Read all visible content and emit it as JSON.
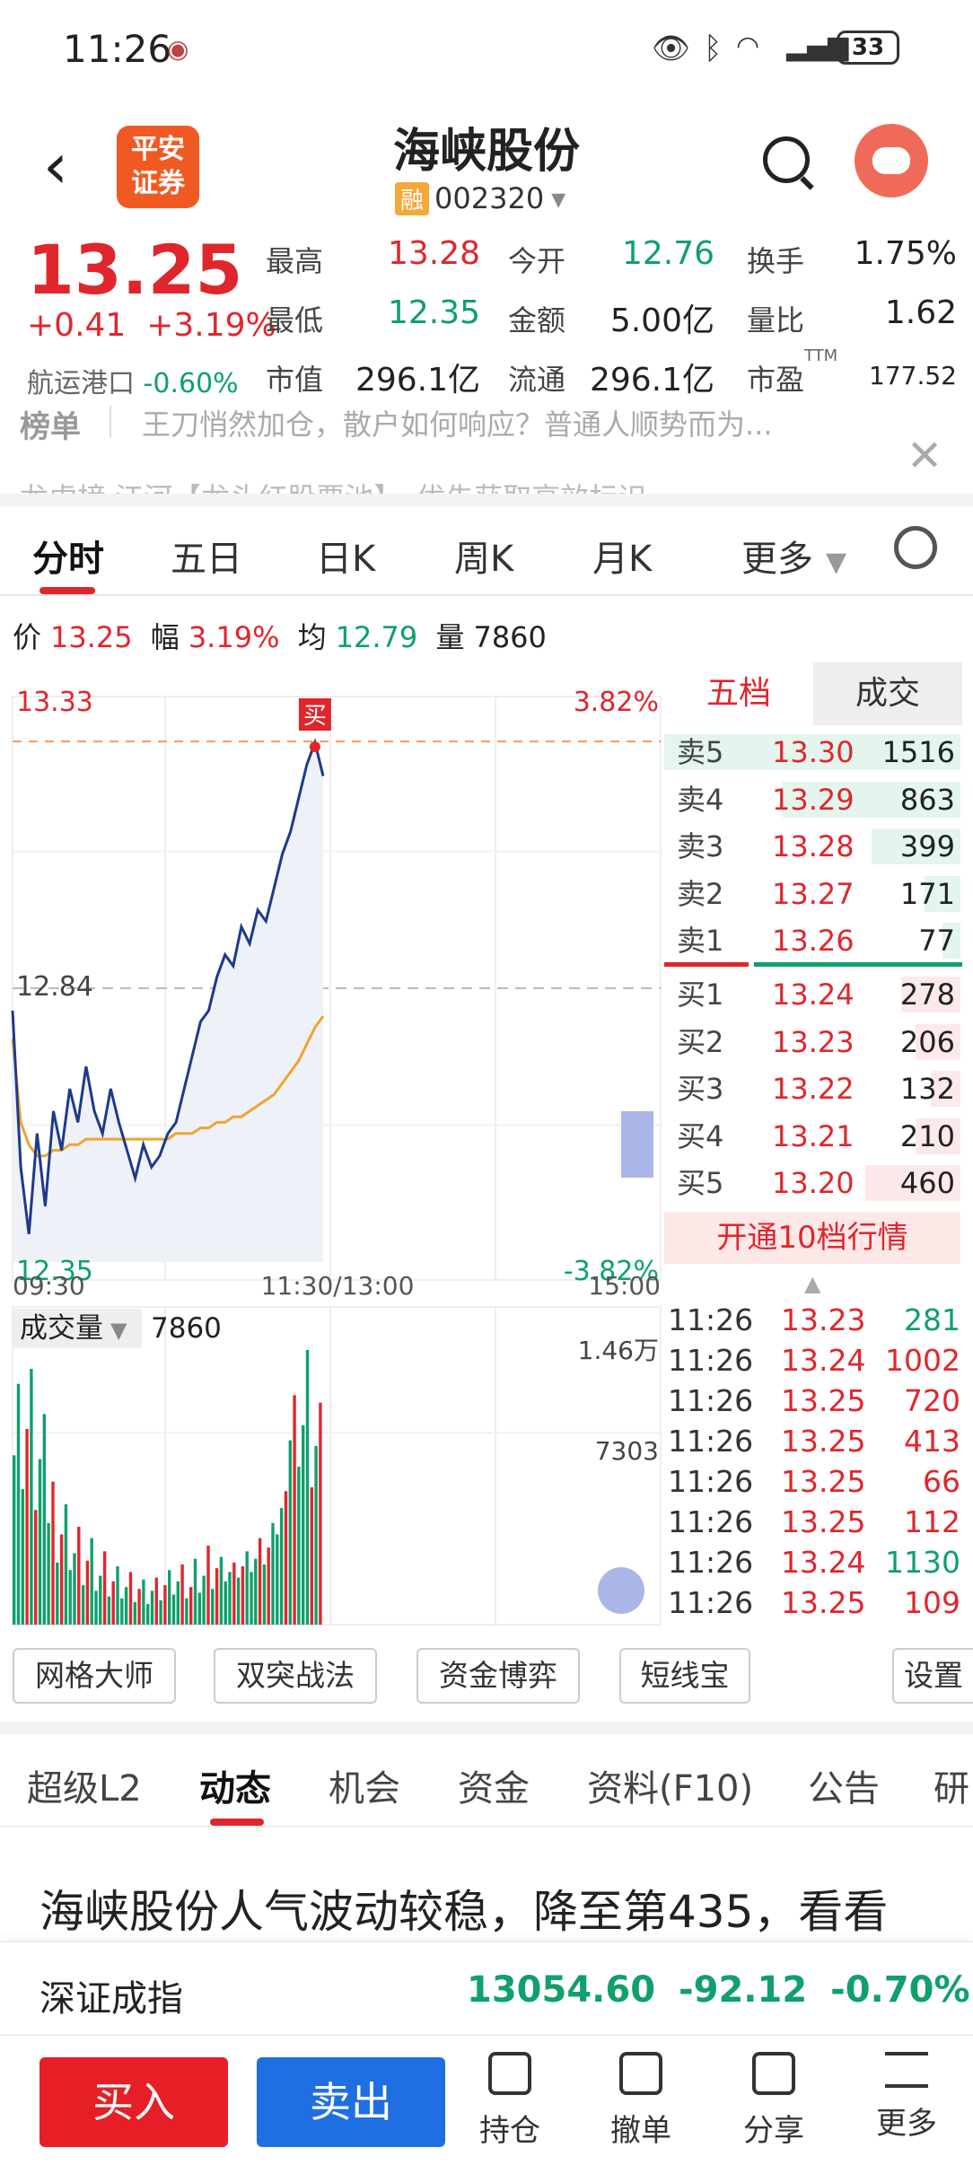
{
  "status_bar": {
    "time": "11:26",
    "battery": "33"
  },
  "header": {
    "back_icon": "back-arrow-icon",
    "broker_logo_line1": "平安",
    "broker_logo_line2": "证券",
    "stock_name": "海峡股份",
    "margin_badge": "融",
    "stock_code": "002320"
  },
  "quote": {
    "price": "13.25",
    "change": "+0.41",
    "change_pct": "+3.19%",
    "related_name": "航运港口",
    "related_pct": "-0.60%",
    "fields": [
      {
        "label": "最高",
        "value": "13.28",
        "color": "red"
      },
      {
        "label": "今开",
        "value": "12.76",
        "color": "green"
      },
      {
        "label": "换手",
        "value": "1.75%",
        "color": "dark"
      },
      {
        "label": "最低",
        "value": "12.35",
        "color": "green"
      },
      {
        "label": "金额",
        "value": "5.00亿",
        "color": "dark"
      },
      {
        "label": "量比",
        "value": "1.62",
        "color": "dark"
      },
      {
        "label": "市值",
        "value": "296.1亿",
        "color": "dark"
      },
      {
        "label": "流通",
        "value": "296.1亿",
        "color": "dark"
      },
      {
        "label": "市盈",
        "value": "177.52",
        "color": "dark"
      }
    ],
    "pe_superscript": "TTM"
  },
  "news": {
    "tag": "榜单",
    "text": "王刀悄然加仓，散户如何响应？普通人顺势而为...",
    "line2": "龙虎榜    江河【龙头红股票池】，优先获取高效标识"
  },
  "chart_tabs": [
    "分时",
    "五日",
    "日K",
    "周K",
    "月K",
    "更多"
  ],
  "info_line": {
    "price_label": "价",
    "price": "13.25",
    "amp_label": "幅",
    "amp": "3.19%",
    "avg_label": "均",
    "avg": "12.79",
    "vol_label": "量",
    "vol": "7860"
  },
  "chart_data": {
    "type": "line",
    "title": "",
    "y_max_label": "13.33",
    "y_mid_label": "12.84",
    "y_min_label": "12.35",
    "pct_max_label": "3.82%",
    "pct_min_label": "-3.82%",
    "x_labels": [
      "09:30",
      "11:30/13:00",
      "15:00"
    ],
    "ylim": [
      12.35,
      13.33
    ],
    "prev_close": 12.84,
    "buy_marker": "买",
    "series": [
      {
        "name": "price",
        "color": "#1e3a8a",
        "values": [
          12.8,
          12.52,
          12.4,
          12.58,
          12.45,
          12.62,
          12.55,
          12.66,
          12.6,
          12.7,
          12.62,
          12.58,
          12.66,
          12.6,
          12.55,
          12.5,
          12.56,
          12.52,
          12.54,
          12.58,
          12.6,
          12.66,
          12.72,
          12.78,
          12.8,
          12.86,
          12.9,
          12.88,
          12.95,
          12.92,
          12.98,
          12.96,
          13.02,
          13.08,
          13.12,
          13.18,
          13.24,
          13.28,
          13.22
        ]
      },
      {
        "name": "avg",
        "color": "#f0a530",
        "values": [
          12.75,
          12.6,
          12.56,
          12.54,
          12.54,
          12.55,
          12.55,
          12.56,
          12.56,
          12.57,
          12.57,
          12.57,
          12.57,
          12.57,
          12.57,
          12.57,
          12.57,
          12.57,
          12.57,
          12.57,
          12.58,
          12.58,
          12.58,
          12.59,
          12.59,
          12.6,
          12.6,
          12.61,
          12.61,
          12.62,
          12.63,
          12.64,
          12.65,
          12.67,
          12.69,
          12.71,
          12.74,
          12.77,
          12.79
        ]
      }
    ],
    "volume_label": "成交量",
    "volume_value": "7860",
    "volume_max_label": "1.46万",
    "volume_mid_label": "7303",
    "volume_max": 14600,
    "volume": [
      9000,
      12800,
      7200,
      10400,
      13600,
      6100,
      8800,
      11200,
      5400,
      7600,
      3300,
      4800,
      6400,
      2900,
      3800,
      5200,
      2100,
      3400,
      4600,
      1800,
      2600,
      3900,
      1500,
      2300,
      3100,
      1400,
      2000,
      2800,
      1200,
      1900,
      2400,
      1100,
      1800,
      2500,
      1300,
      2100,
      2900,
      1600,
      2300,
      3200,
      1400,
      2000,
      3500,
      1700,
      2600,
      4200,
      1900,
      3000,
      3600,
      2300,
      2800,
      3300,
      2500,
      3100,
      3900,
      2800,
      3500,
      4600,
      3200,
      4100,
      5400,
      4800,
      6200,
      7100,
      9800,
      12200,
      8400,
      10600,
      14600,
      7300,
      9500,
      11800
    ]
  },
  "orderbook": {
    "tab_active": "五档",
    "tab_other": "成交",
    "asks": [
      {
        "label": "卖5",
        "price": "13.30",
        "vol": "1516",
        "ratio": 1.0
      },
      {
        "label": "卖4",
        "price": "13.29",
        "vol": "863",
        "ratio": 0.6
      },
      {
        "label": "卖3",
        "price": "13.28",
        "vol": "399",
        "ratio": 0.3
      },
      {
        "label": "卖2",
        "price": "13.27",
        "vol": "171",
        "ratio": 0.12
      },
      {
        "label": "卖1",
        "price": "13.26",
        "vol": "77",
        "ratio": 0.06
      }
    ],
    "bids": [
      {
        "label": "买1",
        "price": "13.24",
        "vol": "278",
        "ratio": 0.2
      },
      {
        "label": "买2",
        "price": "13.23",
        "vol": "206",
        "ratio": 0.15
      },
      {
        "label": "买3",
        "price": "13.22",
        "vol": "132",
        "ratio": 0.1
      },
      {
        "label": "买4",
        "price": "13.21",
        "vol": "210",
        "ratio": 0.15
      },
      {
        "label": "买5",
        "price": "13.20",
        "vol": "460",
        "ratio": 0.32
      }
    ],
    "upgrade_label": "开通10档行情"
  },
  "trades": [
    {
      "time": "11:26",
      "price": "13.23",
      "vol": "281",
      "side": "sell"
    },
    {
      "time": "11:26",
      "price": "13.24",
      "vol": "1002",
      "side": "buy"
    },
    {
      "time": "11:26",
      "price": "13.25",
      "vol": "720",
      "side": "buy"
    },
    {
      "time": "11:26",
      "price": "13.25",
      "vol": "413",
      "side": "buy"
    },
    {
      "time": "11:26",
      "price": "13.25",
      "vol": "66",
      "side": "buy"
    },
    {
      "time": "11:26",
      "price": "13.25",
      "vol": "112",
      "side": "buy"
    },
    {
      "time": "11:26",
      "price": "13.24",
      "vol": "1130",
      "side": "sell"
    },
    {
      "time": "11:26",
      "price": "13.25",
      "vol": "109",
      "side": "buy"
    }
  ],
  "tools": [
    "网格大师",
    "双突战法",
    "资金博弈",
    "短线宝",
    "设置"
  ],
  "info_tabs": [
    "超级L2",
    "动态",
    "机会",
    "资金",
    "资料(F10)",
    "公告",
    "研"
  ],
  "headline": "海峡股份人气波动较稳，降至第435，看看",
  "index_bar": {
    "name": "深证成指",
    "value": "13054.60",
    "change": "-92.12",
    "pct": "-0.70%"
  },
  "actions": {
    "buy": "买入",
    "sell": "卖出",
    "hold": "持仓",
    "cancel": "撤单",
    "share": "分享",
    "more": "更多"
  }
}
